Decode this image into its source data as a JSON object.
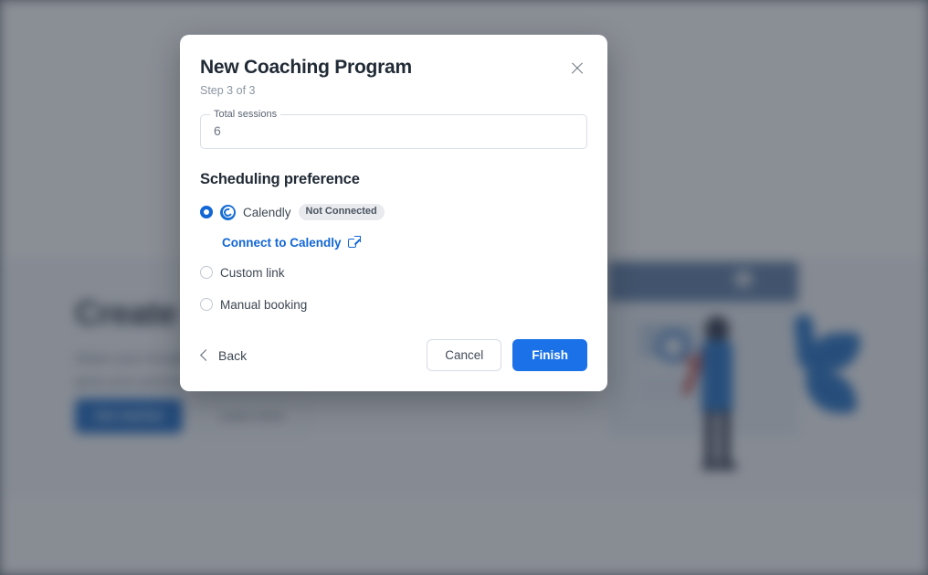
{
  "background": {
    "hero_heading": "Create your coaching program",
    "hero_paragraph": "Share your knowledge with clients, track their progress, and grow your practice.",
    "primary_button": "Get started",
    "secondary_button": "Learn more"
  },
  "modal": {
    "title": "New Coaching Program",
    "step_text": "Step 3 of 3",
    "close_icon": "close-icon",
    "field": {
      "label": "Total sessions",
      "value": "6"
    },
    "section_title": "Scheduling preference",
    "options": [
      {
        "id": "calendly",
        "label": "Calendly",
        "selected": true,
        "badge": "Not Connected",
        "icon": "calendly-logo-icon",
        "link_text": "Connect to Calendly",
        "link_icon": "external-link-icon"
      },
      {
        "id": "custom-link",
        "label": "Custom link",
        "selected": false
      },
      {
        "id": "manual-booking",
        "label": "Manual booking",
        "selected": false
      }
    ],
    "footer": {
      "back_label": "Back",
      "back_icon": "chevron-left-icon",
      "cancel_label": "Cancel",
      "finish_label": "Finish"
    }
  },
  "colors": {
    "accent": "#1b72e8",
    "link": "#1266d6",
    "scrim": "#2e3642",
    "badge_bg": "#e8eaee"
  }
}
